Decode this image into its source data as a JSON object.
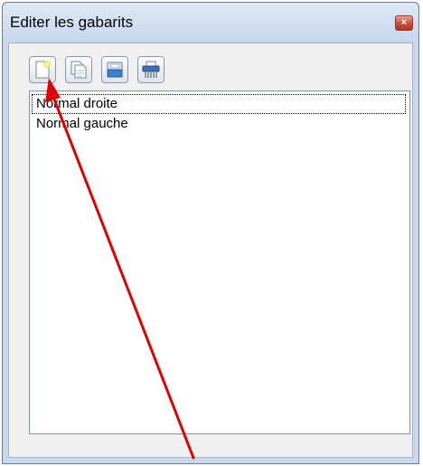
{
  "window": {
    "title": "Editer les gabarits",
    "close_label": "×"
  },
  "toolbar": {
    "buttons": [
      {
        "icon": "new-document-icon"
      },
      {
        "icon": "copy-document-icon"
      },
      {
        "icon": "open-folder-icon"
      },
      {
        "icon": "shredder-icon"
      }
    ]
  },
  "templates": {
    "items": [
      {
        "label": "Normal droite"
      },
      {
        "label": "Normal gauche"
      }
    ]
  },
  "colors": {
    "annotation_arrow": "#e00000",
    "title_bar": "#c6d6ec",
    "close_button": "#c94a36"
  }
}
